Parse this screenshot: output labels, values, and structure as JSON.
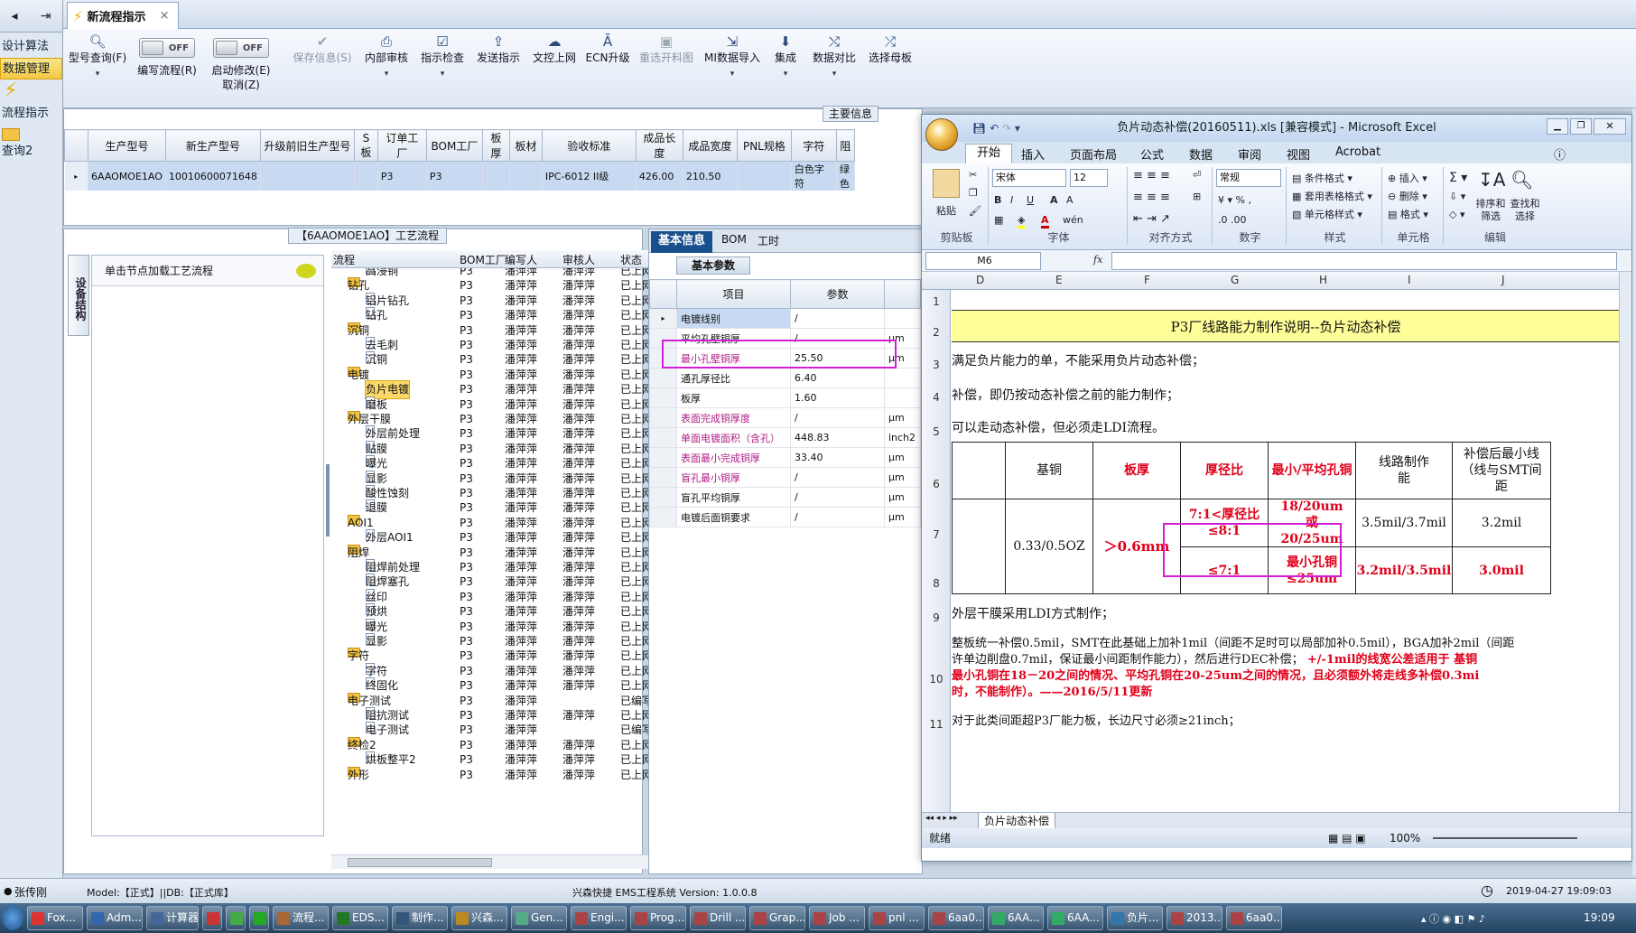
{
  "left_nav": {
    "items": [
      "设计算法",
      "数据管理",
      "流程指示",
      "查询2"
    ]
  },
  "tab": {
    "title": "新流程指示",
    "close": "×"
  },
  "ribbon": {
    "query": "型号查询(F)",
    "edit_toggle": {
      "label": "编写流程(R)",
      "state": "OFF"
    },
    "start_toggle": {
      "label": "启动修改(E)",
      "label2": "取消(Z)",
      "state": "OFF"
    },
    "save": "保存信息(S)",
    "internal_review": "内部审核",
    "check": "指示检查",
    "send": "发送指示",
    "online": "文控上网",
    "ecn": "ECN升级",
    "reselect": "重选开料图",
    "mi_import": "MI数据导入",
    "integrate": "集成",
    "compare": "数据对比",
    "template": "选择母板"
  },
  "main_info": {
    "caption": "主要信息",
    "columns": [
      "生产型号",
      "新生产型号",
      "升级前旧生产型号",
      "S板",
      "订单工厂",
      "BOM工厂",
      "板厚",
      "板材",
      "验收标准",
      "成品长度",
      "成品宽度",
      "PNL规格",
      "字符",
      "阻"
    ],
    "row": [
      "6AAOMOE1AO",
      "10010600071648",
      "",
      "",
      "P3",
      "P3",
      "",
      "",
      "IPC-6012 II级",
      "426.00",
      "210.50",
      "",
      "白色字符",
      "绿色"
    ]
  },
  "flow": {
    "caption": "【6AAOMOE1AO】工艺流程",
    "vtab": "设备结构",
    "hint": "单击节点加载工艺流程",
    "columns": [
      "流程",
      "BOM工厂",
      "编写人",
      "审核人",
      "状态"
    ],
    "rows": [
      {
        "level": 2,
        "name": "高浸铜",
        "bom": "P3",
        "writer": "潘萍萍",
        "reviewer": "潘萍萍",
        "status": "已上网",
        "type": "doc"
      },
      {
        "level": 1,
        "name": "钻孔",
        "bom": "P3",
        "writer": "潘萍萍",
        "reviewer": "潘萍萍",
        "status": "已上网",
        "type": "folder"
      },
      {
        "level": 2,
        "name": "铝片钻孔",
        "bom": "P3",
        "writer": "潘萍萍",
        "reviewer": "潘萍萍",
        "status": "已上网",
        "type": "doc"
      },
      {
        "level": 2,
        "name": "钻孔",
        "bom": "P3",
        "writer": "潘萍萍",
        "reviewer": "潘萍萍",
        "status": "已上网",
        "type": "doc"
      },
      {
        "level": 1,
        "name": "沉铜",
        "bom": "P3",
        "writer": "潘萍萍",
        "reviewer": "潘萍萍",
        "status": "已上网",
        "type": "folder"
      },
      {
        "level": 2,
        "name": "去毛刺",
        "bom": "P3",
        "writer": "潘萍萍",
        "reviewer": "潘萍萍",
        "status": "已上网",
        "type": "doc"
      },
      {
        "level": 2,
        "name": "沉铜",
        "bom": "P3",
        "writer": "潘萍萍",
        "reviewer": "潘萍萍",
        "status": "已上网",
        "type": "doc"
      },
      {
        "level": 1,
        "name": "电镀",
        "bom": "P3",
        "writer": "潘萍萍",
        "reviewer": "潘萍萍",
        "status": "已上网",
        "type": "folder"
      },
      {
        "level": 2,
        "name": "负片电镀",
        "bom": "P3",
        "writer": "潘萍萍",
        "reviewer": "潘萍萍",
        "status": "已上网",
        "type": "doc",
        "selected": true
      },
      {
        "level": 2,
        "name": "磨板",
        "bom": "P3",
        "writer": "潘萍萍",
        "reviewer": "潘萍萍",
        "status": "已上网",
        "type": "doc"
      },
      {
        "level": 1,
        "name": "外层干膜",
        "bom": "P3",
        "writer": "潘萍萍",
        "reviewer": "潘萍萍",
        "status": "已上网",
        "type": "folder"
      },
      {
        "level": 2,
        "name": "外层前处理",
        "bom": "P3",
        "writer": "潘萍萍",
        "reviewer": "潘萍萍",
        "status": "已上网",
        "type": "doc"
      },
      {
        "level": 2,
        "name": "贴膜",
        "bom": "P3",
        "writer": "潘萍萍",
        "reviewer": "潘萍萍",
        "status": "已上网",
        "type": "doc"
      },
      {
        "level": 2,
        "name": "曝光",
        "bom": "P3",
        "writer": "潘萍萍",
        "reviewer": "潘萍萍",
        "status": "已上网",
        "type": "doc"
      },
      {
        "level": 2,
        "name": "显影",
        "bom": "P3",
        "writer": "潘萍萍",
        "reviewer": "潘萍萍",
        "status": "已上网",
        "type": "doc"
      },
      {
        "level": 2,
        "name": "酸性蚀刻",
        "bom": "P3",
        "writer": "潘萍萍",
        "reviewer": "潘萍萍",
        "status": "已上网",
        "type": "doc"
      },
      {
        "level": 2,
        "name": "退膜",
        "bom": "P3",
        "writer": "潘萍萍",
        "reviewer": "潘萍萍",
        "status": "已上网",
        "type": "doc"
      },
      {
        "level": 1,
        "name": "AOI1",
        "bom": "P3",
        "writer": "潘萍萍",
        "reviewer": "潘萍萍",
        "status": "已上网",
        "type": "folder"
      },
      {
        "level": 2,
        "name": "外层AOI1",
        "bom": "P3",
        "writer": "潘萍萍",
        "reviewer": "潘萍萍",
        "status": "已上网",
        "type": "doc"
      },
      {
        "level": 1,
        "name": "阻焊",
        "bom": "P3",
        "writer": "潘萍萍",
        "reviewer": "潘萍萍",
        "status": "已上网",
        "type": "folder"
      },
      {
        "level": 2,
        "name": "阻焊前处理",
        "bom": "P3",
        "writer": "潘萍萍",
        "reviewer": "潘萍萍",
        "status": "已上网",
        "type": "doc"
      },
      {
        "level": 2,
        "name": "阻焊塞孔",
        "bom": "P3",
        "writer": "潘萍萍",
        "reviewer": "潘萍萍",
        "status": "已上网",
        "type": "doc"
      },
      {
        "level": 2,
        "name": "丝印",
        "bom": "P3",
        "writer": "潘萍萍",
        "reviewer": "潘萍萍",
        "status": "已上网",
        "type": "doc"
      },
      {
        "level": 2,
        "name": "预烘",
        "bom": "P3",
        "writer": "潘萍萍",
        "reviewer": "潘萍萍",
        "status": "已上网",
        "type": "doc"
      },
      {
        "level": 2,
        "name": "曝光",
        "bom": "P3",
        "writer": "潘萍萍",
        "reviewer": "潘萍萍",
        "status": "已上网",
        "type": "doc"
      },
      {
        "level": 2,
        "name": "显影",
        "bom": "P3",
        "writer": "潘萍萍",
        "reviewer": "潘萍萍",
        "status": "已上网",
        "type": "doc"
      },
      {
        "level": 1,
        "name": "字符",
        "bom": "P3",
        "writer": "潘萍萍",
        "reviewer": "潘萍萍",
        "status": "已上网",
        "type": "folder"
      },
      {
        "level": 2,
        "name": "字符",
        "bom": "P3",
        "writer": "潘萍萍",
        "reviewer": "潘萍萍",
        "status": "已上网",
        "type": "doc"
      },
      {
        "level": 2,
        "name": "终固化",
        "bom": "P3",
        "writer": "潘萍萍",
        "reviewer": "潘萍萍",
        "status": "已上网",
        "type": "doc"
      },
      {
        "level": 1,
        "name": "电子测试",
        "bom": "P3",
        "writer": "潘萍萍",
        "reviewer": "",
        "status": "已编写",
        "type": "folder"
      },
      {
        "level": 2,
        "name": "阻抗测试",
        "bom": "P3",
        "writer": "潘萍萍",
        "reviewer": "潘萍萍",
        "status": "已上网",
        "type": "doc"
      },
      {
        "level": 2,
        "name": "电子测试",
        "bom": "P3",
        "writer": "潘萍萍",
        "reviewer": "",
        "status": "已编写",
        "type": "doc"
      },
      {
        "level": 1,
        "name": "终检2",
        "bom": "P3",
        "writer": "潘萍萍",
        "reviewer": "潘萍萍",
        "status": "已上网",
        "type": "folder"
      },
      {
        "level": 2,
        "name": "烘板整平2",
        "bom": "P3",
        "writer": "潘萍萍",
        "reviewer": "潘萍萍",
        "status": "已上网",
        "type": "doc"
      },
      {
        "level": 1,
        "name": "外形",
        "bom": "P3",
        "writer": "潘萍萍",
        "reviewer": "潘萍萍",
        "status": "已上网",
        "type": "folder"
      }
    ]
  },
  "basic": {
    "tabs": [
      "基本信息",
      "BOM",
      "工时"
    ],
    "section": "基本参数",
    "columns": [
      "项目",
      "参数"
    ],
    "rows": [
      {
        "item": "电镀线别",
        "value": "/",
        "unit": "",
        "pink": false
      },
      {
        "item": "平均孔壁铜厚",
        "value": "/",
        "unit": "μm",
        "pink": false
      },
      {
        "item": "最小孔壁铜厚",
        "value": "25.50",
        "unit": "μm",
        "pink": true
      },
      {
        "item": "通孔厚径比",
        "value": "6.40",
        "unit": "",
        "pink": false
      },
      {
        "item": "板厚",
        "value": "1.60",
        "unit": "",
        "pink": false
      },
      {
        "item": "表面完成铜厚度",
        "value": "/",
        "unit": "μm",
        "pink": true
      },
      {
        "item": "单面电镀面积（含孔）",
        "value": "448.83",
        "unit": "inch2",
        "pink": true
      },
      {
        "item": "表面最小完成铜厚",
        "value": "33.40",
        "unit": "μm",
        "pink": true
      },
      {
        "item": "盲孔最小铜厚",
        "value": "/",
        "unit": "μm",
        "pink": true
      },
      {
        "item": "盲孔平均铜厚",
        "value": "/",
        "unit": "μm",
        "pink": false
      },
      {
        "item": "电镀后面铜要求",
        "value": "/",
        "unit": "μm",
        "pink": false
      }
    ]
  },
  "excel": {
    "title": "负片动态补偿(20160511).xls  [兼容模式] - Microsoft Excel",
    "tabs": [
      "开始",
      "插入",
      "页面布局",
      "公式",
      "数据",
      "审阅",
      "视图",
      "Acrobat"
    ],
    "groups": [
      "剪贴板",
      "字体",
      "对齐方式",
      "数字",
      "样式",
      "单元格",
      "编辑"
    ],
    "paste": "粘贴",
    "font": "宋体",
    "font_size": "12",
    "number_format": "常规",
    "styles": [
      "条件格式",
      "套用表格格式",
      "单元格样式"
    ],
    "cells_btns": [
      "插入",
      "删除",
      "格式"
    ],
    "edit_btns": [
      "排序和筛选",
      "查找和选择"
    ],
    "name_box": "M6",
    "fx": "fx",
    "columns": [
      "D",
      "E",
      "F",
      "G",
      "H",
      "I",
      "J"
    ],
    "rows": [
      "1",
      "2",
      "3",
      "4",
      "5",
      "6",
      "7",
      "8",
      "9",
      "10",
      "11"
    ],
    "title_row": "P3厂线路能力制作说明--负片动态补偿",
    "line3": "满足负片能力的单，不能采用负片动态补偿；",
    "line4": "补偿，即仍按动态补偿之前的能力制作；",
    "line5": "可以走动态补偿，但必须走LDI流程。",
    "headers": [
      "基铜",
      "板厚",
      "厚径比",
      "最小/平均孔铜",
      "线路制作能",
      "补偿后最小线（线与SMT间距"
    ],
    "r7": {
      "base": "0.33/0.5OZ",
      "thick": "＞0.6mm",
      "ratio": "7:1<厚径比≤8:1",
      "cu": "18/20um或20/25um",
      "line": "3.5mil/3.7mil",
      "comp": "3.2mil"
    },
    "r8": {
      "ratio": "≤7:1",
      "cu": "最小孔铜≤25um",
      "line": "3.2mil/3.5mil",
      "comp": "3.0mil"
    },
    "line9": "外层干膜采用LDI方式制作；",
    "line10a": "整板统一补偿0.5mil，SMT在此基础上加补1mil（间距不足时可以局部加补0.5mil），BGA加补2mil（间距",
    "line10b": "许单边削盘0.7mil，保证最小间距制作能力），然后进行DEC补偿；",
    "line10b_red": "+/-1mil的线宽公差适用于 基铜",
    "line10c": "最小孔铜在18－20之间的情况、平均孔铜在20-25um之间的情况，且必须额外将走线多补偿0.3mi",
    "line10d": "时，不能制作）。——2016/5/11更新",
    "line11": "对于此类间距超P3厂能力板，长边尺寸必须≥21inch；",
    "sheet_tab": "负片动态补偿",
    "status_ready": "就绪",
    "zoom": "100%"
  },
  "statusbar": {
    "user": "张传刚",
    "model": "Model:【正式】||DB:【正式库】",
    "system": "兴森快捷 EMS工程系统 Version: 1.0.0.8",
    "datetime": "2019-04-27 19:09:03"
  },
  "taskbar": {
    "items": [
      "Fox...",
      "Adm...",
      "计算器",
      "",
      "",
      "",
      "流程...",
      "EDS...",
      "制作...",
      "兴森...",
      "Gen...",
      "Engi...",
      "Prog...",
      "Drill ...",
      "Grap...",
      "Job ...",
      "pnl ...",
      "6aa0...",
      "6AA...",
      "6AA...",
      "负片...",
      "2013...",
      "6aa0..."
    ],
    "clock": "19:09"
  }
}
